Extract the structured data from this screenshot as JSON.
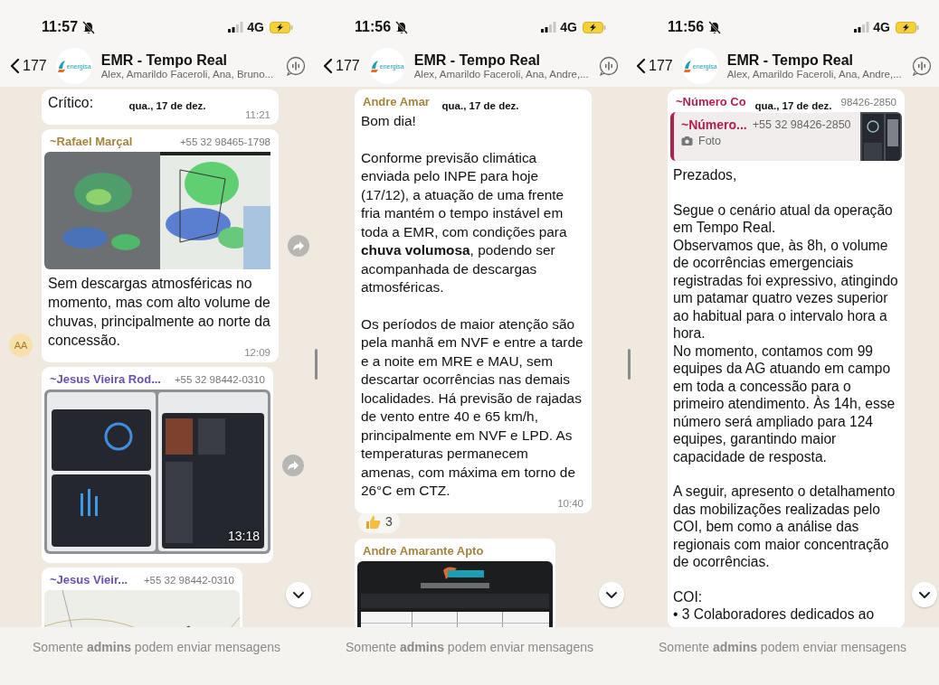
{
  "screens": [
    {
      "status": {
        "time": "11:57",
        "network": "4G"
      },
      "header": {
        "back_count": "177",
        "logo": "energisa",
        "title": "EMR - Tempo Real",
        "members": "Alex, Amarildo Faceroli, Ana, Bruno..."
      },
      "date_chip": "qua., 17 de dez.",
      "messages": [
        {
          "kind": "text",
          "paragraphs": [
            "Crítico:"
          ],
          "time": "11:21"
        },
        {
          "sender": "~Rafael Marçal",
          "color": "#a5843e",
          "phone": "+55 32 98465-1798",
          "paragraphs": [
            "Sem descargas atmosféricas no momento, mas com alto volume de chuvas, principalmente ao norte da concessão."
          ],
          "time": "12:09",
          "avatar": "AA",
          "forward": true
        },
        {
          "sender": "~Jesus Vieira Rod...",
          "color": "#6b4fae",
          "phone": "+55 32 98442-0310",
          "time": "13:18",
          "forward": true
        },
        {
          "sender": "~Jesus Vieir...",
          "color": "#6b4fae",
          "phone": "+55 32 98442-0310"
        }
      ],
      "footer": "Somente **admins** podem enviar mensagens"
    },
    {
      "status": {
        "time": "11:56",
        "network": "4G"
      },
      "header": {
        "back_count": "177",
        "logo": "energisa",
        "title": "EMR - Tempo Real",
        "members": "Alex, Amarildo Faceroli, Ana, Andre,..."
      },
      "date_chip": "qua., 17 de dez.",
      "messages": [
        {
          "kind": "text",
          "sender": "Andre Amar",
          "color": "#a5843e",
          "paragraphs": [
            "Bom dia!",
            "Conforme previsão climática enviada pelo INPE para hoje (17/12), a atuação de uma frente fria mantém o tempo instável em toda a EMR, com condições para **chuva volumosa**, podendo ser acompanhada de descargas atmosféricas.",
            "Os períodos de maior atenção são pela manhã em NVF e entre a tarde e a noite em MRE e MAU, sem descartar ocorrências nas demais localidades. Há previsão de rajadas de vento entre 40 e 65 km/h, principalmente em NVF e LPD. As temperaturas permanecem amenas, com máxima em torno de 26°C em CTZ."
          ],
          "time": "10:40",
          "reaction": "3"
        },
        {
          "sender": "Andre Amarante Apto",
          "color": "#a5843e"
        }
      ],
      "footer": "Somente **admins** podem enviar mensagens"
    },
    {
      "status": {
        "time": "11:56",
        "network": "4G"
      },
      "header": {
        "back_count": "177",
        "logo": "energisa",
        "title": "EMR - Tempo Real",
        "members": "Alex, Amarildo Faceroli, Ana, Andre,..."
      },
      "date_chip": "qua., 17 de dez.",
      "messages": [
        {
          "kind": "text",
          "sender": "~Número Co",
          "color": "#b3204e",
          "phone": "98426-2850",
          "quote": {
            "sender": "~Número...",
            "phone": "+55 32 98426-2850",
            "label": "Foto"
          },
          "paragraphs": [
            "Prezados,",
            "Segue o cenário atual da operação em Tempo Real.\nObservamos que, às 8h, o volume de ocorrências emergenciais registradas foi expressivo, atingindo um patamar quatro vezes superior ao habitual para o intervalo hora a hora.\nNo momento, contamos com 99 equipes da AG atuando em campo em toda a concessão para o primeiro atendimento. Às 14h, esse número será ampliado para 124 equipes, garantindo maior capacidade de resposta.",
            "A seguir, apresento o detalhamento das mobilizações realizadas pelo COI, bem como a análise das regionais com maior concentração de ocorrências.",
            "COI:\n• 3 Colaboradores dedicados ao"
          ]
        }
      ],
      "footer": "Somente **admins** podem enviar mensagens"
    }
  ]
}
